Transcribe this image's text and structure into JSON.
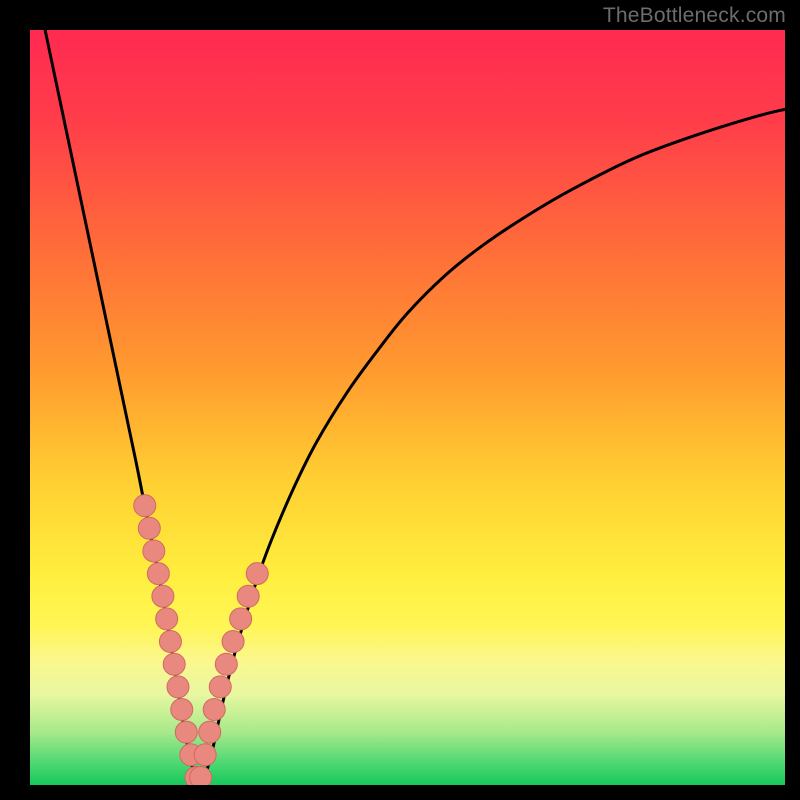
{
  "watermark": "TheBottleneck.com",
  "colors": {
    "frame": "#000000",
    "gradient_stops": [
      {
        "offset": 0.0,
        "color": "#ff2a51"
      },
      {
        "offset": 0.12,
        "color": "#ff3d4a"
      },
      {
        "offset": 0.28,
        "color": "#ff6a3a"
      },
      {
        "offset": 0.45,
        "color": "#ff9a2f"
      },
      {
        "offset": 0.6,
        "color": "#ffd032"
      },
      {
        "offset": 0.72,
        "color": "#ffee3e"
      },
      {
        "offset": 0.79,
        "color": "#fff655"
      },
      {
        "offset": 0.835,
        "color": "#fbf78d"
      },
      {
        "offset": 0.88,
        "color": "#e8f7a0"
      },
      {
        "offset": 0.93,
        "color": "#a7e98a"
      },
      {
        "offset": 0.97,
        "color": "#4fd873"
      },
      {
        "offset": 1.0,
        "color": "#17c85b"
      }
    ],
    "curve": "#000000",
    "marker_fill": "#e9887f",
    "marker_stroke": "#cf6a63"
  },
  "chart_data": {
    "type": "line",
    "title": "",
    "xlabel": "",
    "ylabel": "",
    "xlim": [
      0,
      100
    ],
    "ylim": [
      0,
      100
    ],
    "x_min_at": 22,
    "series": [
      {
        "name": "bottleneck-curve",
        "x": [
          2,
          4,
          6,
          8,
          10,
          12,
          14,
          15,
          16,
          17,
          18,
          19,
          20,
          21,
          22,
          23,
          24,
          25,
          26,
          27,
          28,
          30,
          32,
          35,
          38,
          42,
          46,
          50,
          55,
          60,
          66,
          72,
          80,
          88,
          96,
          100
        ],
        "y": [
          100,
          90.5,
          81,
          71.5,
          62,
          52.5,
          43,
          38,
          33,
          28,
          22.5,
          16.5,
          10,
          4.5,
          1.0,
          1.0,
          4.0,
          8.5,
          13,
          17,
          20.5,
          27,
          32.5,
          39.5,
          45.5,
          52,
          57.5,
          62.5,
          67.5,
          71.5,
          75.5,
          79,
          83,
          86,
          88.5,
          89.5
        ]
      }
    ],
    "markers": {
      "name": "highlight-points",
      "x": [
        15.2,
        15.8,
        16.4,
        17.0,
        17.6,
        18.1,
        18.6,
        19.1,
        19.6,
        20.1,
        20.7,
        21.3,
        22.0,
        22.6,
        23.2,
        23.8,
        24.4,
        25.2,
        26.0,
        26.9,
        27.9,
        28.9,
        30.1
      ],
      "y": [
        37.0,
        34.0,
        31.0,
        28.0,
        25.0,
        22.0,
        19.0,
        16.0,
        13.0,
        10.0,
        7.0,
        4.0,
        1.0,
        1.0,
        4.0,
        7.0,
        10.0,
        13.0,
        16.0,
        19.0,
        22.0,
        25.0,
        28.0
      ]
    }
  }
}
